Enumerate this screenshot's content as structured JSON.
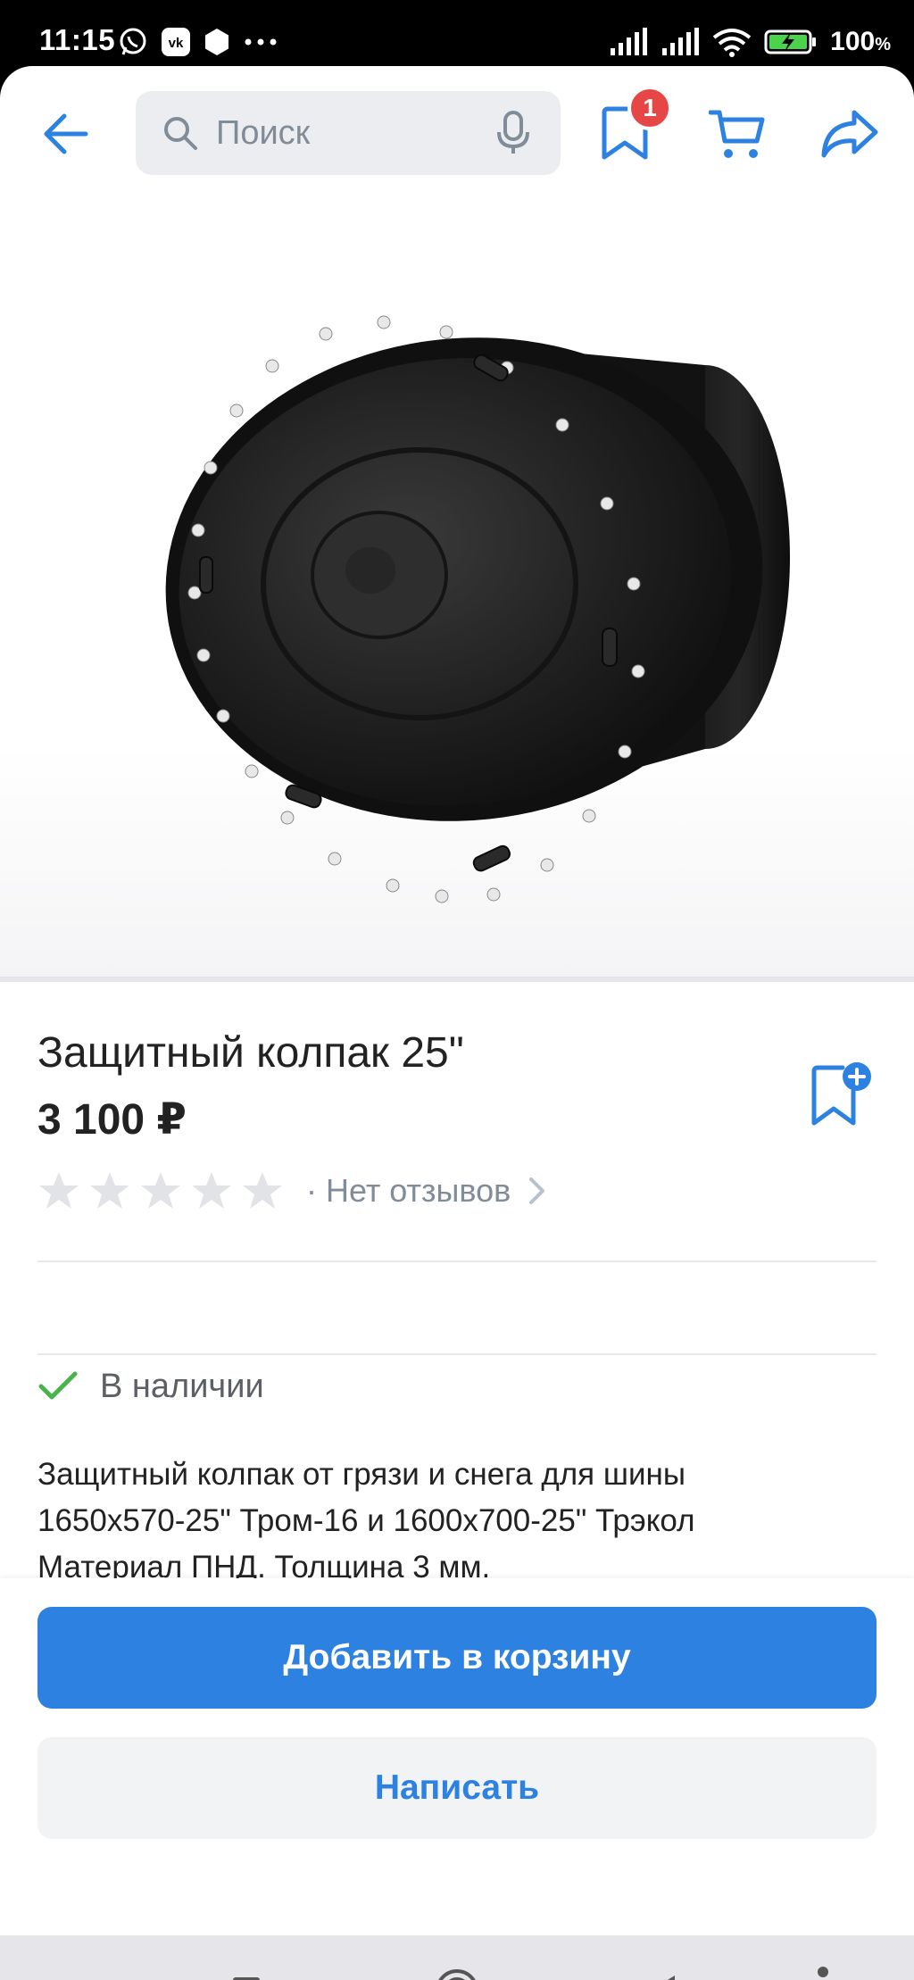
{
  "status_bar": {
    "time": "11:15",
    "battery_percent": "100",
    "battery_unit": "%"
  },
  "header": {
    "search_placeholder": "Поиск",
    "favorites_badge": "1"
  },
  "product": {
    "title": "Защитный колпак 25\"",
    "price": "3 100 ₽",
    "rating_stars_filled": 0,
    "rating_stars_total": 5,
    "reviews_label": "· Нет отзывов",
    "availability": "В наличии",
    "description_lines": [
      "Защитный колпак от грязи и снега для шины",
      "1650x570-25\" Тром-16 и 1600x700-25\" Трэкол",
      "Материал ПНД. Толщина 3 мм."
    ]
  },
  "actions": {
    "add_to_cart": "Добавить в корзину",
    "write": "Написать"
  },
  "colors": {
    "accent": "#2d81e0",
    "badge": "#e64646",
    "check": "#4bb34b",
    "muted": "#818c99"
  },
  "icons": {
    "header": [
      "back-arrow-icon",
      "search-icon",
      "mic-icon",
      "bookmark-icon",
      "cart-icon",
      "share-icon"
    ],
    "nav": [
      "recents-icon",
      "home-icon",
      "back-triangle-icon",
      "accessibility-icon"
    ]
  }
}
